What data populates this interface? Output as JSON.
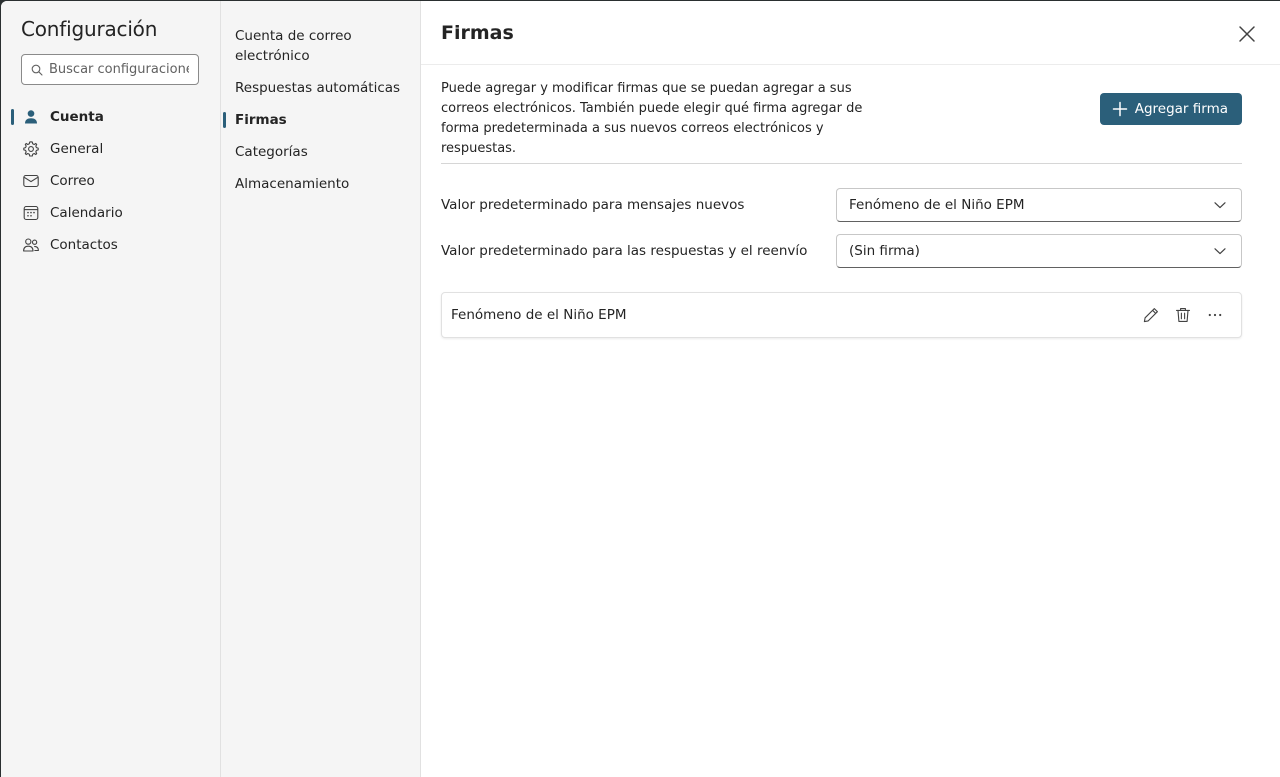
{
  "settings": {
    "title": "Configuración",
    "search": {
      "placeholder": "Buscar configuraciones"
    }
  },
  "primary_nav": {
    "items": [
      {
        "label": "Cuenta",
        "icon": "person-icon",
        "active": true
      },
      {
        "label": "General",
        "icon": "gear-icon",
        "active": false
      },
      {
        "label": "Correo",
        "icon": "mail-icon",
        "active": false
      },
      {
        "label": "Calendario",
        "icon": "calendar-icon",
        "active": false
      },
      {
        "label": "Contactos",
        "icon": "people-icon",
        "active": false
      }
    ]
  },
  "secondary_nav": {
    "items": [
      {
        "label": "Cuenta de correo electrónico",
        "active": false
      },
      {
        "label": "Respuestas automáticas",
        "active": false
      },
      {
        "label": "Firmas",
        "active": true
      },
      {
        "label": "Categorías",
        "active": false
      },
      {
        "label": "Almacenamiento",
        "active": false
      }
    ]
  },
  "page": {
    "title": "Firmas",
    "description": "Puede agregar y modificar firmas que se puedan agregar a sus correos electrónicos. También puede elegir qué firma agregar de forma predeterminada a sus nuevos correos electrónicos y respuestas.",
    "add_button_label": "Agregar firma",
    "defaults": {
      "new_messages_label": "Valor predeterminado para mensajes nuevos",
      "new_messages_value": "Fenómeno de el Niño EPM",
      "replies_label": "Valor predeterminado para las respuestas y el reenvío",
      "replies_value": "(Sin firma)"
    },
    "signatures": [
      {
        "name": "Fenómeno de el Niño EPM"
      }
    ]
  },
  "colors": {
    "accent": "#2b5f7a",
    "sidebar_bg": "#f5f5f5",
    "text": "#242424"
  }
}
